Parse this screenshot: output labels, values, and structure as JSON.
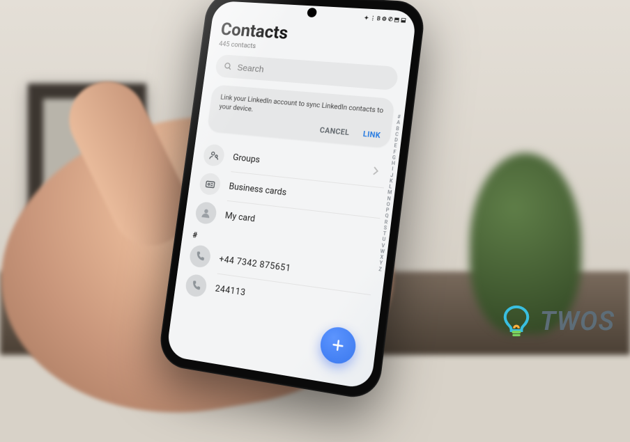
{
  "statusbar": {
    "time": "",
    "icons": "✦ ⋮ B ⚙ ✆ ⬒ ⬓"
  },
  "header": {
    "title": "Contacts",
    "subtitle": "445 contacts"
  },
  "search": {
    "placeholder": "Search"
  },
  "linkedin_card": {
    "text": "Link your LinkedIn account to sync LinkedIn contacts to your device.",
    "cancel": "CANCEL",
    "link": "LINK"
  },
  "nav": {
    "groups": "Groups",
    "business_cards": "Business cards",
    "my_card": "My card"
  },
  "section_hash": "#",
  "contacts": [
    {
      "number": "+44 7342  875651"
    },
    {
      "number": "244113"
    }
  ],
  "index_letters": [
    "#",
    "A",
    "B",
    "C",
    "D",
    "E",
    "F",
    "G",
    "H",
    "I",
    "J",
    "K",
    "L",
    "M",
    "N",
    "O",
    "P",
    "Q",
    "R",
    "S",
    "T",
    "U",
    "V",
    "W",
    "X",
    "Y",
    "Z"
  ],
  "brand": "TWOS"
}
